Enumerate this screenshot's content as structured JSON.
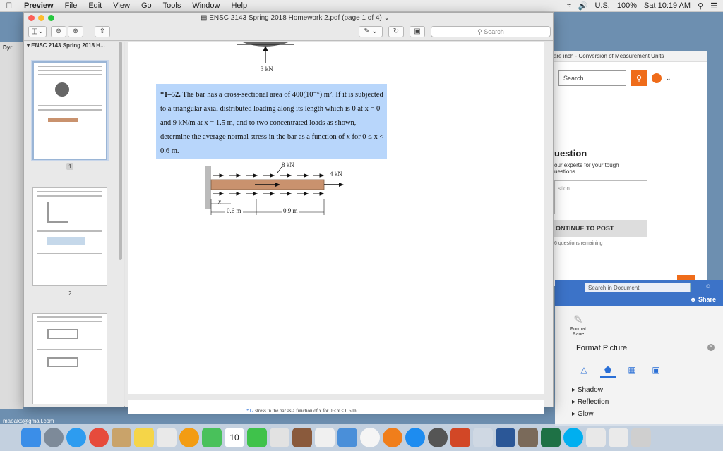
{
  "menubar": {
    "app": "Preview",
    "items": [
      "File",
      "Edit",
      "View",
      "Go",
      "Tools",
      "Window",
      "Help"
    ],
    "input_source": "U.S.",
    "battery": "100%",
    "clock": "Sat 10:19 AM"
  },
  "window": {
    "title": "ENSC 2143 Spring 2018 Homework 2.pdf (page 1 of 4)",
    "search_placeholder": "Search",
    "sidebar_title": "ENSC 2143 Spring 2018 H...",
    "page_numbers": [
      "1",
      "2"
    ],
    "desktop_label": "Dyr"
  },
  "problem": {
    "number": "*1–52.",
    "text": "The bar has a cross-sectional area of 400(10⁻⁶) m². If it is subjected to a triangular axial distributed loading along its length which is 0 at x = 0 and 9 kN/m at x = 1.5 m, and to two concentrated loads as shown, determine the average normal stress in the bar as a function of x for 0 ≤ x < 0.6 m.",
    "top_load": "3 kN",
    "load_8kn": "8 kN",
    "load_4kn": "4 kN",
    "dim_06": "0.6 m",
    "dim_09": "0.9 m",
    "x_label": "x",
    "footer_ref": "*12",
    "footer_text": "stress in the bar as a function of x for 0 ≤ x < 0.6 m."
  },
  "web": {
    "tab_title": "quare inch - Conversion of Measurement Units",
    "search_placeholder": "Search",
    "question_heading": "uestion",
    "question_sub": "our experts for your tough uestions",
    "question_placeholder": "stion",
    "post_button": "ONTINUE TO POST",
    "remaining": "6 questions remaining"
  },
  "word": {
    "doc_search": "Search in Document",
    "share": "Share",
    "format_pane_label": "Format Pane",
    "pane_title": "Format Picture",
    "options": [
      "Shadow",
      "Reflection",
      "Glow"
    ]
  },
  "desktop": {
    "email": "maoaks@gmail.com",
    "dock_badge_calendar": "10"
  },
  "colors": {
    "highlight": "#b8d6fb",
    "bar": "#c9926e",
    "chegg_orange": "#ef6c1a",
    "word_blue": "#3c73c8"
  }
}
